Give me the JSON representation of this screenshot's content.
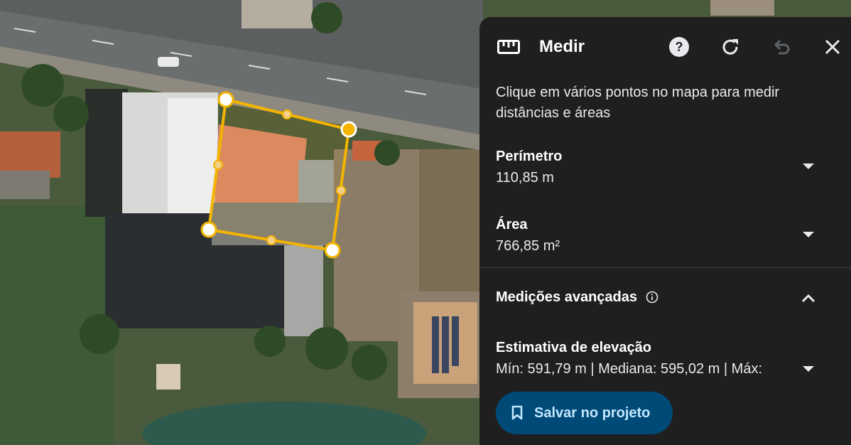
{
  "map": {
    "colors": {
      "polygon": "#f4b400",
      "vertex_fill": "#ffffff"
    }
  },
  "panel": {
    "title": "Medir",
    "icons": {
      "ruler": "ruler-icon",
      "help": "help-icon",
      "reset": "reset-icon",
      "undo": "undo-icon",
      "close": "close-icon"
    },
    "description": "Clique em vários pontos no mapa para medir distâncias e áreas",
    "perimeter": {
      "label": "Perímetro",
      "value": "110,85 m"
    },
    "area": {
      "label": "Área",
      "value": "766,85 m²"
    },
    "advanced": {
      "label": "Medições avançadas",
      "info_icon": "info-icon"
    },
    "elevation": {
      "label": "Estimativa de elevação",
      "value": "Mín: 591,79 m | Mediana: 595,02 m | Máx:"
    },
    "save_button": {
      "label": "Salvar no projeto",
      "icon": "bookmark-icon"
    },
    "colors": {
      "background": "#1f1f1f",
      "button_bg": "#004a77",
      "button_text": "#c2e7ff"
    }
  }
}
